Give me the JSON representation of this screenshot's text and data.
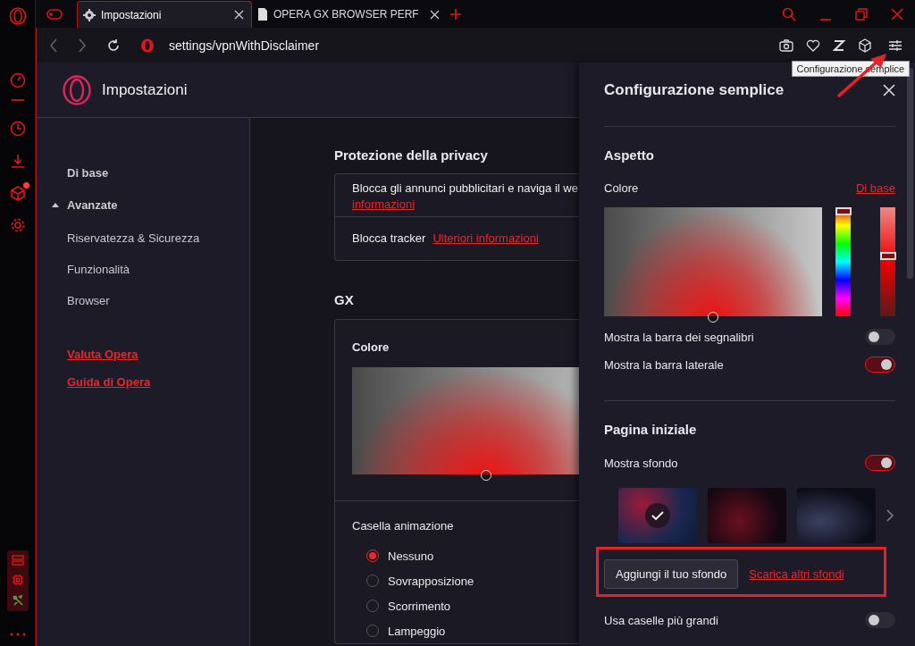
{
  "tabs": [
    {
      "label": "Impostazioni",
      "selected": true,
      "kind": "settings"
    },
    {
      "label": "OPERA GX BROWSER PERF",
      "selected": false,
      "kind": "document"
    }
  ],
  "address": "settings/vpnWithDisclaimer",
  "tooltip": "Configurazione semplice",
  "sidebar": [
    {
      "kind": "speed",
      "notification": false
    },
    {
      "kind": "history",
      "notification": false
    },
    {
      "kind": "download",
      "notification": false
    },
    {
      "kind": "cube",
      "notification": true
    },
    {
      "kind": "settings",
      "notification": false
    }
  ],
  "settings_title": "Impostazioni",
  "nav": [
    {
      "label": "Di base",
      "kind": "item"
    },
    {
      "label": "Avanzate",
      "kind": "group",
      "expanded": true
    },
    {
      "label": "Riservatezza & Sicurezza",
      "kind": "item"
    },
    {
      "label": "Funzionalità",
      "kind": "item"
    },
    {
      "label": "Browser",
      "kind": "item"
    },
    {
      "label": "Valuta Opera",
      "kind": "link"
    },
    {
      "label": "Guida di Opera",
      "kind": "link"
    }
  ],
  "privacy": {
    "title": "Protezione della privacy",
    "rows": [
      {
        "text": "Blocca gli annunci pubblicitari e naviga il we",
        "link": "informazioni",
        "kind": "stacked"
      },
      {
        "text": "Blocca tracker",
        "link": "Ulteriori informazioni",
        "kind": "inline"
      }
    ]
  },
  "gx": {
    "title": "GX",
    "color_label": "Colore",
    "animation_label": "Casella animazione",
    "animations": [
      {
        "label": "Nessuno",
        "selected": true
      },
      {
        "label": "Sovrapposizione",
        "selected": false
      },
      {
        "label": "Scorrimento",
        "selected": false
      },
      {
        "label": "Lampeggio",
        "selected": false
      }
    ]
  },
  "panel": {
    "title": "Configurazione semplice",
    "appearance": {
      "title": "Aspetto",
      "color_label": "Colore",
      "reset_link": "Di base",
      "hue": {
        "level": 1
      },
      "shade": {
        "level": 0.56
      },
      "toggles": [
        {
          "label": "Mostra la barra dei segnalibri",
          "on": false
        },
        {
          "label": "Mostra la barra laterale",
          "on": true
        }
      ]
    },
    "home": {
      "title": "Pagina iniziale",
      "background_toggle": {
        "label": "Mostra sfondo",
        "on": true
      },
      "wallpapers": [
        {
          "selected": true
        },
        {
          "selected": false
        },
        {
          "selected": false
        }
      ],
      "add_button": "Aggiungi il tuo sfondo",
      "more_link": "Scarica altri sfondi",
      "toggles": [
        {
          "label": "Usa caselle più grandi",
          "on": false
        }
      ]
    }
  }
}
